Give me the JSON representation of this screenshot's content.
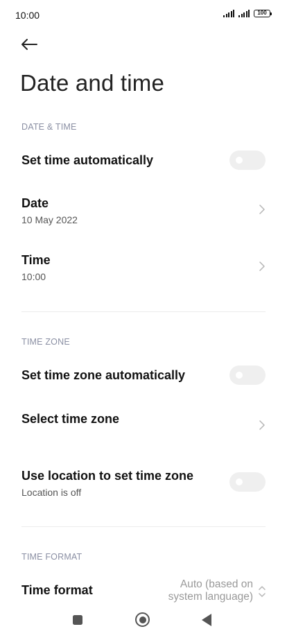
{
  "status_bar": {
    "time": "10:00",
    "battery": "100"
  },
  "page": {
    "title": "Date and time"
  },
  "sections": {
    "date_time": {
      "header": "DATE & TIME",
      "set_time_auto": {
        "label": "Set time automatically",
        "enabled": false
      },
      "date": {
        "label": "Date",
        "value": "10 May 2022"
      },
      "time": {
        "label": "Time",
        "value": "10:00"
      }
    },
    "time_zone": {
      "header": "TIME ZONE",
      "set_zone_auto": {
        "label": "Set time zone automatically",
        "enabled": false
      },
      "select_zone": {
        "label": "Select time zone"
      },
      "use_location": {
        "label": "Use location to set time zone",
        "sub": "Location is off",
        "enabled": false
      }
    },
    "time_format": {
      "header": "TIME FORMAT",
      "format": {
        "label": "Time format",
        "value_line1": "Auto (based on",
        "value_line2": "system language)"
      }
    }
  },
  "icons": {
    "back": "arrow-left-icon",
    "chevron": "chevron-right-icon",
    "updown": "chevron-up-down-icon"
  },
  "colors": {
    "section_header": "#8a8fa3",
    "toggle_off": "#efefef",
    "divider": "#ececec"
  }
}
